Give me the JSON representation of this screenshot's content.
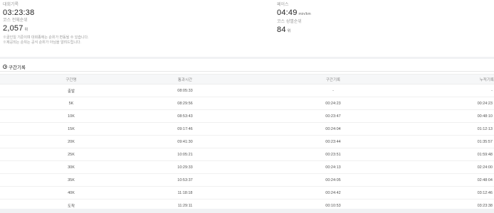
{
  "summary": {
    "record_label": "대회기록",
    "record_value": "03:23:38",
    "course_rank_label": "코스 전체순위",
    "course_rank_value": "2,057",
    "course_rank_unit": "위",
    "note1": "※골인일 기준이며 대회종에는 순위가 변동될 수 있습니다.",
    "note2": "※제공되는 순위는 공식 순위가 아님을 알려드립니다.",
    "pace_label": "페이스",
    "pace_value": "04:49",
    "pace_unit": "min/km",
    "gender_rank_label": "코스 성별순위",
    "gender_rank_value": "84",
    "gender_rank_unit": "위"
  },
  "splits": {
    "title": "구간기록",
    "headers": [
      "구간명",
      "통과시간",
      "구간기록",
      "누적기록"
    ],
    "rows": [
      [
        "출발",
        "08:05:33",
        "-",
        "-"
      ],
      [
        "5K",
        "08:29:56",
        "00:24:23",
        "00:24:23"
      ],
      [
        "10K",
        "08:53:43",
        "00:23:47",
        "00:48:10"
      ],
      [
        "15K",
        "09:17:46",
        "00:24:04",
        "01:12:13"
      ],
      [
        "20K",
        "09:41:30",
        "00:23:44",
        "01:35:57"
      ],
      [
        "25K",
        "10:05:21",
        "00:23:51",
        "01:59:48"
      ],
      [
        "30K",
        "10:29:33",
        "00:24:13",
        "02:24:00"
      ],
      [
        "35K",
        "10:53:37",
        "00:24:05",
        "02:48:04"
      ],
      [
        "40K",
        "11:18:18",
        "00:24:42",
        "03:12:46"
      ],
      [
        "도착",
        "11:29:11",
        "00:10:53",
        "03:23:38"
      ]
    ]
  }
}
